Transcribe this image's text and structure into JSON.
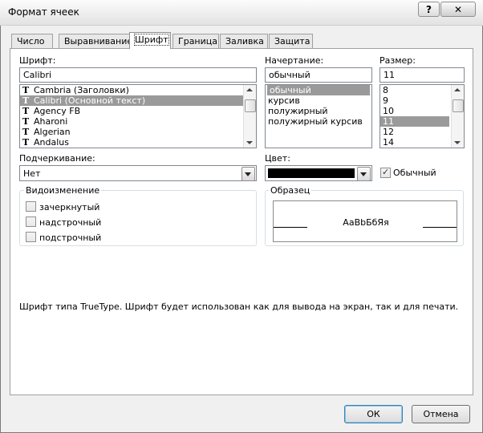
{
  "window": {
    "title": "Формат ячеек",
    "help_label": "?",
    "close_label": "✕"
  },
  "tabs": [
    {
      "label": "Число"
    },
    {
      "label": "Выравнивание"
    },
    {
      "label": "Шрифт",
      "active": true
    },
    {
      "label": "Граница"
    },
    {
      "label": "Заливка"
    },
    {
      "label": "Защита"
    }
  ],
  "font": {
    "label": "Шрифт:",
    "value": "Calibri",
    "items": [
      "Cambria (Заголовки)",
      "Calibri (Основной текст)",
      "Agency FB",
      "Aharoni",
      "Algerian",
      "Andalus"
    ],
    "selected": "Calibri (Основной текст)",
    "type_icon": "truetype-icon"
  },
  "style": {
    "label": "Начертание:",
    "value": "обычный",
    "items": [
      "обычный",
      "курсив",
      "полужирный",
      "полужирный курсив"
    ],
    "selected": "обычный"
  },
  "size": {
    "label": "Размер:",
    "value": "11",
    "items": [
      "8",
      "9",
      "10",
      "11",
      "12",
      "14"
    ],
    "selected": "11"
  },
  "underline": {
    "label": "Подчеркивание:",
    "value": "Нет"
  },
  "color": {
    "label": "Цвет:",
    "swatch": "#000000",
    "normal_label": "Обычный",
    "normal_checked": true
  },
  "effects": {
    "label": "Видоизменение",
    "items": [
      {
        "label": "зачеркнутый",
        "checked": false
      },
      {
        "label": "надстрочный",
        "checked": false
      },
      {
        "label": "подстрочный",
        "checked": false
      }
    ]
  },
  "preview": {
    "label": "Образец",
    "text": "AaBbБбЯя"
  },
  "description": "Шрифт типа TrueType. Шрифт будет использован как для вывода на экран, так и для печати.",
  "buttons": {
    "ok": "ОК",
    "cancel": "Отмена"
  },
  "colors": {
    "selection": "#9a9a9a",
    "default_button_border": "#3c7fb1"
  }
}
